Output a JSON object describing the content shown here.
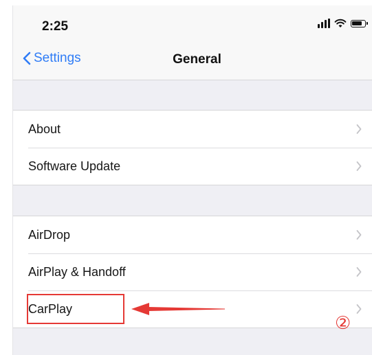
{
  "status_bar": {
    "time": "2:25"
  },
  "nav": {
    "back_label": "Settings",
    "title": "General"
  },
  "groups": [
    {
      "rows": [
        {
          "label": "About"
        },
        {
          "label": "Software Update"
        }
      ]
    },
    {
      "rows": [
        {
          "label": "AirDrop"
        },
        {
          "label": "AirPlay & Handoff"
        },
        {
          "label": "CarPlay"
        }
      ]
    }
  ],
  "annotation": {
    "step": "②",
    "color": "#e53935"
  },
  "colors": {
    "accent": "#2f7cf6",
    "background": "#efeff4",
    "annotation": "#e53935"
  },
  "icons": [
    "signal-icon",
    "wifi-icon",
    "battery-icon",
    "back-chevron-icon",
    "chevron-right-icon",
    "arrow-left-icon"
  ]
}
